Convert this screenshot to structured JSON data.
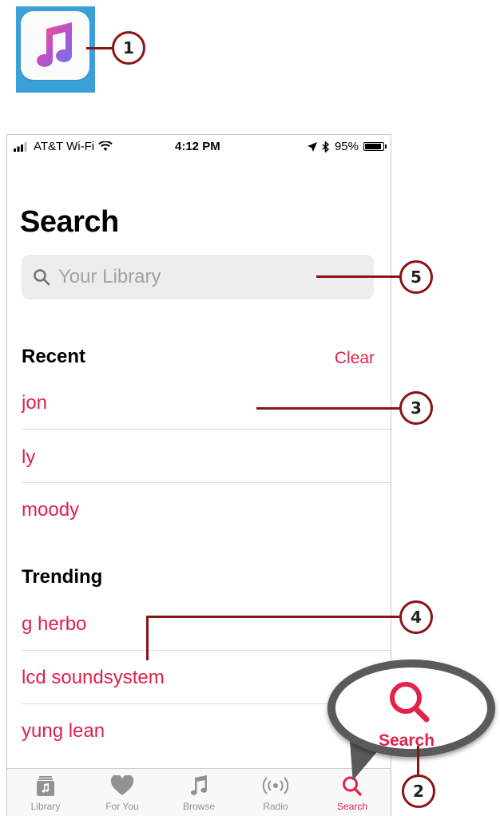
{
  "status_bar": {
    "carrier": "AT&T Wi-Fi",
    "time": "4:12 PM",
    "battery": "95%"
  },
  "page": {
    "title": "Search"
  },
  "search": {
    "placeholder": "Your Library"
  },
  "recent": {
    "header": "Recent",
    "clear_label": "Clear",
    "items": [
      "jon",
      "ly",
      "moody"
    ]
  },
  "trending": {
    "header": "Trending",
    "items": [
      "g herbo",
      "lcd soundsystem",
      "yung lean"
    ]
  },
  "tab_bar": {
    "tabs": [
      {
        "label": "Library",
        "icon": "library-icon"
      },
      {
        "label": "For You",
        "icon": "heart-icon"
      },
      {
        "label": "Browse",
        "icon": "music-note-icon"
      },
      {
        "label": "Radio",
        "icon": "radio-icon"
      },
      {
        "label": "Search",
        "icon": "search-icon"
      }
    ],
    "active": "Search"
  },
  "magnifier": {
    "label": "Search"
  },
  "callouts": [
    "1",
    "2",
    "3",
    "4",
    "5"
  ],
  "colors": {
    "accent": "#e3224b",
    "callout_line": "#8a1414"
  }
}
